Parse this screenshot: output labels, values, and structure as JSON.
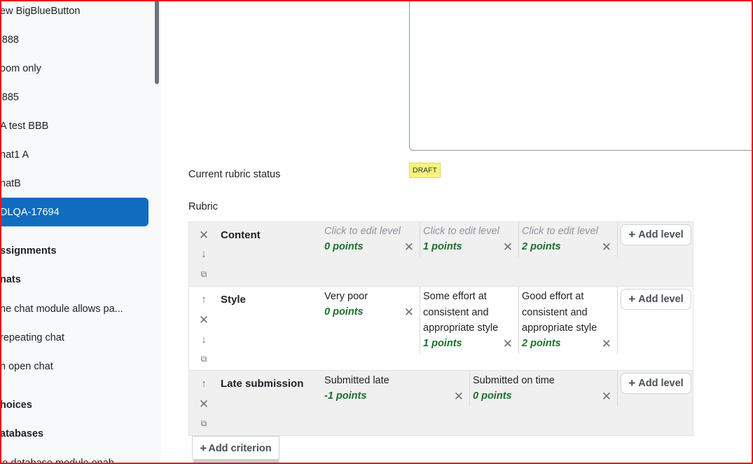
{
  "sidebar": {
    "items": [
      {
        "label": "ew BigBlueButton"
      },
      {
        "label": "'888"
      },
      {
        "label": "oom only"
      },
      {
        "label": "'885"
      },
      {
        "label": "A test BBB"
      },
      {
        "label": "nat1 A"
      },
      {
        "label": "natB"
      },
      {
        "label": "DLQA-17694",
        "active": true
      },
      {
        "label": "ssignments",
        "section": true
      },
      {
        "label": "nats",
        "section": true
      },
      {
        "label": "ne chat module allows pa..."
      },
      {
        "label": "repeating chat"
      },
      {
        "label": "n open chat"
      },
      {
        "label": "hoices",
        "section": true
      },
      {
        "label": "atabases",
        "section": true
      },
      {
        "label": "ie database module enab..."
      }
    ]
  },
  "main": {
    "status_label": "Current rubric status",
    "status_badge": "DRAFT",
    "rubric_label": "Rubric",
    "add_level_label": "Add level",
    "add_criterion_label": "Add criterion",
    "criteria": [
      {
        "name": "Content",
        "levels": [
          {
            "description": "Click to edit level",
            "points": "0 points",
            "placeholder": true
          },
          {
            "description": "Click to edit level",
            "points": "1 points",
            "placeholder": true
          },
          {
            "description": "Click to edit level",
            "points": "2 points",
            "placeholder": true
          }
        ]
      },
      {
        "name": "Style",
        "levels": [
          {
            "description": "Very poor",
            "points": "0 points"
          },
          {
            "description": "Some effort at consistent and appropriate style",
            "points": "1 points"
          },
          {
            "description": "Good effort at consistent and appropriate style",
            "points": "2 points"
          }
        ]
      },
      {
        "name": "Late submission",
        "levels": [
          {
            "description": "Submitted late",
            "points": "-1 points"
          },
          {
            "description": "Submitted on time",
            "points": "0 points"
          }
        ]
      }
    ]
  },
  "icons": {
    "delete": "times-icon",
    "move_up": "arrow-up-icon",
    "move_down": "arrow-down-icon",
    "duplicate": "copy-icon",
    "add": "plus-icon"
  },
  "colors": {
    "accent": "#0f6cbf",
    "points": "#1f6d2f",
    "draft_badge": "#f6f37e",
    "frame": "#e8161b"
  }
}
